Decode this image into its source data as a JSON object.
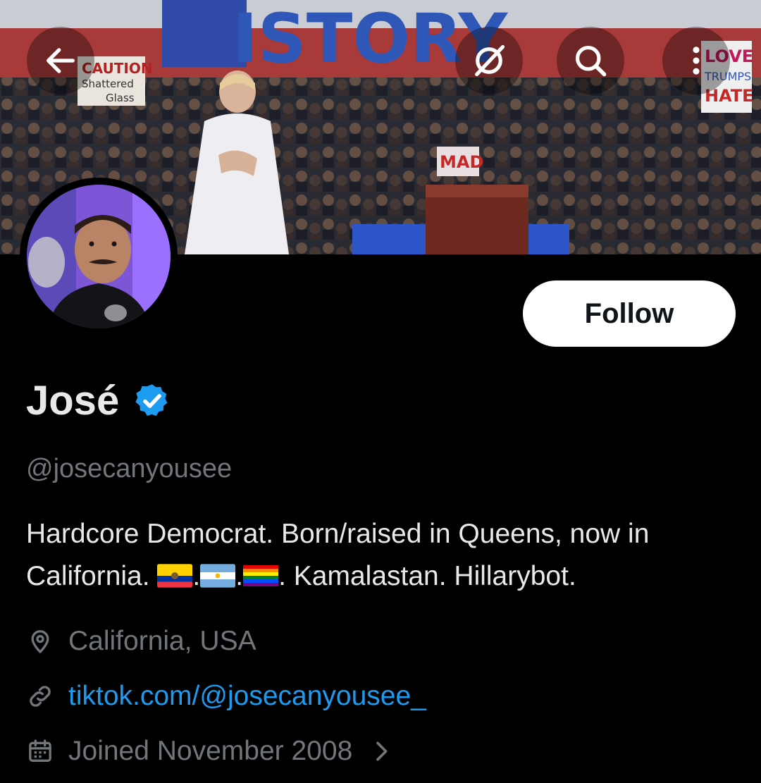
{
  "banner": {
    "sign_text": "ISTORY",
    "sign_caution": "CAUTION",
    "sign_shattered": "Shattered",
    "sign_glass": "Glass",
    "sign_love": "LOVE",
    "sign_trumps": "TRUMPS",
    "sign_hate": "HATE",
    "sign_mad": "MAD"
  },
  "topbar": {
    "back_icon": "arrow-left-icon",
    "grok_icon": "slash-circle-icon",
    "search_icon": "search-icon",
    "more_icon": "more-vertical-icon"
  },
  "profile": {
    "name": "José",
    "handle": "@josecanyousee",
    "follow_label": "Follow",
    "bio_part1": "Hardcore Democrat. Born/raised in Queens, now in California.",
    "bio_sep": ".",
    "bio_part2": ". Kamalastan. Hillarybot.",
    "flags": [
      "ecuador-flag",
      "argentina-flag",
      "rainbow-flag"
    ],
    "location": "California, USA",
    "link": "tiktok.com/@josecanyousee_",
    "joined": "Joined November 2008"
  },
  "colors": {
    "background": "#000000",
    "text": "#e7e9ea",
    "muted": "#71767b",
    "link": "#1d9bf0",
    "verified": "#1d9bf0"
  }
}
